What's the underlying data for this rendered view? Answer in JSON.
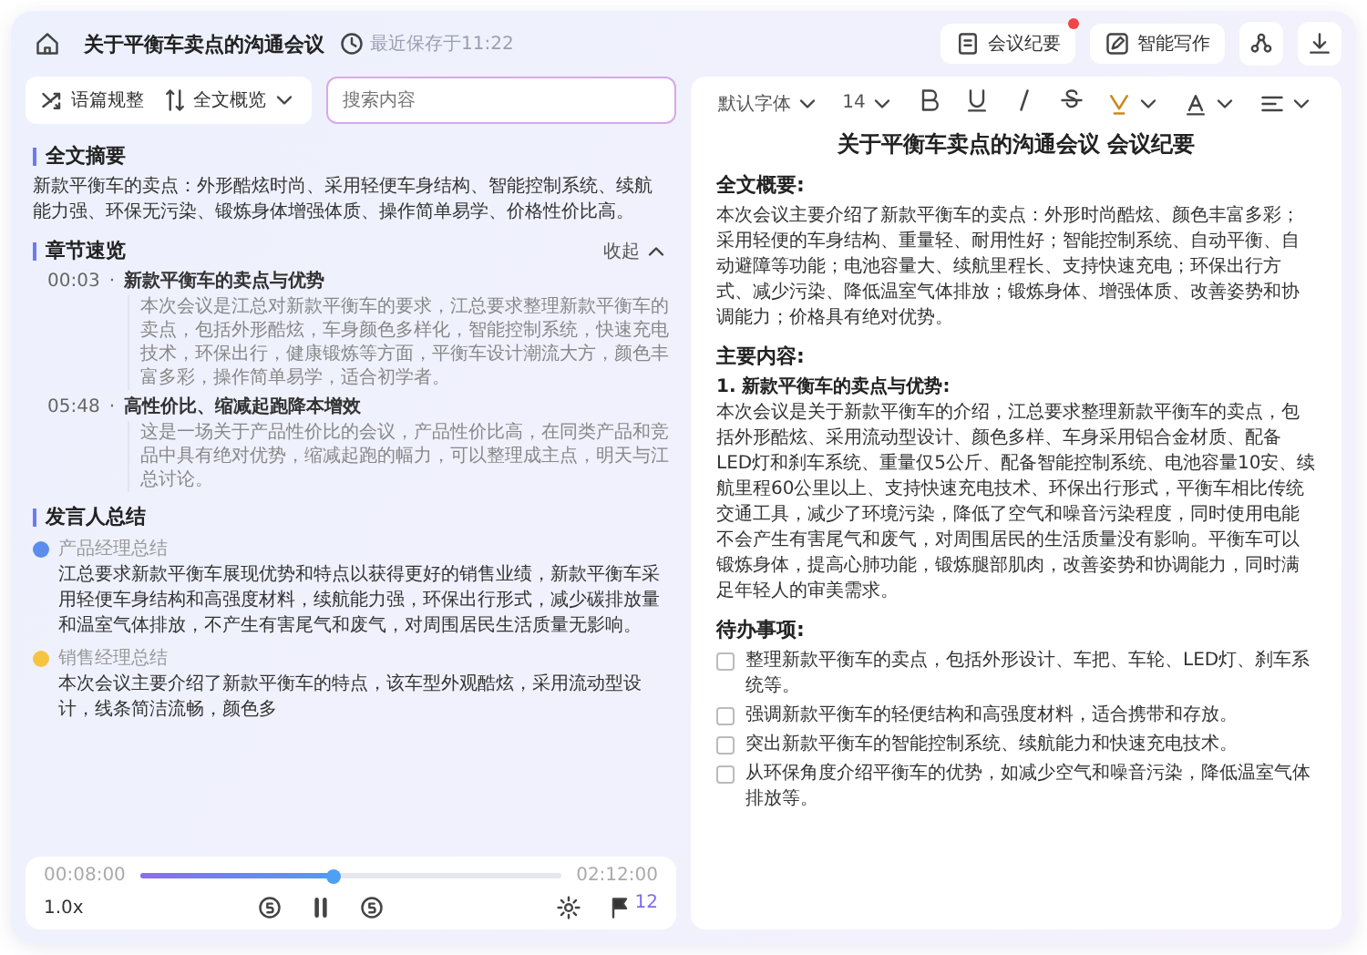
{
  "header": {
    "title": "关于平衡车卖点的沟通会议",
    "saved": "最近保存于11:22",
    "buttons": [
      {
        "label": "会议纪要",
        "badge": true
      },
      {
        "label": "智能写作",
        "badge": false
      }
    ]
  },
  "left": {
    "view_tabs": [
      {
        "label": "语篇规整",
        "kind": "toggle"
      },
      {
        "label": "全文概览",
        "kind": "dropdown"
      }
    ],
    "search": {
      "placeholder": "搜索内容"
    },
    "summary": {
      "heading": "全文摘要",
      "text": "新款平衡车的卖点：外形酷炫时尚、采用轻便车身结构、智能控制系统、续航能力强、环保无污染、锻炼身体增强体质、操作简单易学、价格性价比高。"
    },
    "chapters": {
      "heading": "章节速览",
      "collapse": "收起",
      "bullet": "·",
      "items": [
        {
          "time": "00:03",
          "title": "新款平衡车的卖点与优势",
          "text": "本次会议是江总对新款平衡车的要求，江总要求整理新款平衡车的卖点，包括外形酷炫，车身颜色多样化，智能控制系统，快速充电技术，环保出行，健康锻炼等方面，平衡车设计潮流大方，颜色丰富多彩，操作简单易学，适合初学者。"
        },
        {
          "time": "05:48",
          "title": "高性价比、缩减起跑降本增效",
          "text": "这是一场关于产品性价比的会议，产品性价比高，在同类产品和竞品中具有绝对优势，缩减起跑的幅力，可以整理成主点，明天与江总讨论。"
        }
      ]
    },
    "speakers": {
      "heading": "发言人总结",
      "items": [
        {
          "name": "产品经理总结",
          "color": "#5b8def",
          "text": "江总要求新款平衡车展现优势和特点以获得更好的销售业绩，新款平衡车采用轻便车身结构和高强度材料，续航能力强，环保出行形式，减少碳排放量和温室气体排放，不产生有害尾气和废气，对周围居民生活质量无影响。"
        },
        {
          "name": "销售经理总结",
          "color": "#f5c542",
          "text": "本次会议主要介绍了新款平衡车的特点，该车型外观酷炫，采用流动型设计，线条简洁流畅，颜色多"
        }
      ]
    }
  },
  "player": {
    "elapsed": "00:08:00",
    "total": "02:12:00",
    "level": 0.46,
    "speed": "1.0x",
    "flag_count": "12"
  },
  "editor": {
    "toolbar": {
      "font": "默认字体",
      "size": "14"
    },
    "title": "关于平衡车卖点的沟通会议 会议纪要",
    "sections": [
      {
        "heading": "全文概要:",
        "blocks": [
          {
            "kind": "paragraph",
            "text": "本次会议主要介绍了新款平衡车的卖点：外形时尚酷炫、颜色丰富多彩；采用轻便的车身结构、重量轻、耐用性好；智能控制系统、自动平衡、自动避障等功能；电池容量大、续航里程长、支持快速充电；环保出行方式、减少污染、降低温室气体排放；锻炼身体、增强体质、改善姿势和协调能力；价格具有绝对优势。"
          }
        ]
      },
      {
        "heading": "主要内容:",
        "blocks": [
          {
            "kind": "subheading",
            "text": "1. 新款平衡车的卖点与优势:"
          },
          {
            "kind": "paragraph",
            "text": "本次会议是关于新款平衡车的介绍，江总要求整理新款平衡车的卖点，包括外形酷炫、采用流动型设计、颜色多样、车身采用铝合金材质、配备LED灯和刹车系统、重量仅5公斤、配备智能控制系统、电池容量10安、续航里程60公里以上、支持快速充电技术、环保出行形式，平衡车相比传统交通工具，减少了环境污染，降低了空气和噪音污染程度，同时使用电能不会产生有害尾气和废气，对周围居民的生活质量没有影响。平衡车可以锻炼身体，提高心肺功能，锻炼腿部肌肉，改善姿势和协调能力，同时满足年轻人的审美需求。"
          }
        ]
      }
    ],
    "todos": {
      "heading": "待办事项:",
      "items": [
        {
          "text": "整理新款平衡车的卖点，包括外形设计、车把、车轮、LED灯、刹车系统等。",
          "checked": false
        },
        {
          "text": "强调新款平衡车的轻便结构和高强度材料，适合携带和存放。",
          "checked": false
        },
        {
          "text": "突出新款平衡车的智能控制系统、续航能力和快速充电技术。",
          "checked": false
        },
        {
          "text": "从环保角度介绍平衡车的优势，如减少空气和噪音污染，降低温室气体排放等。",
          "checked": false
        }
      ]
    }
  }
}
